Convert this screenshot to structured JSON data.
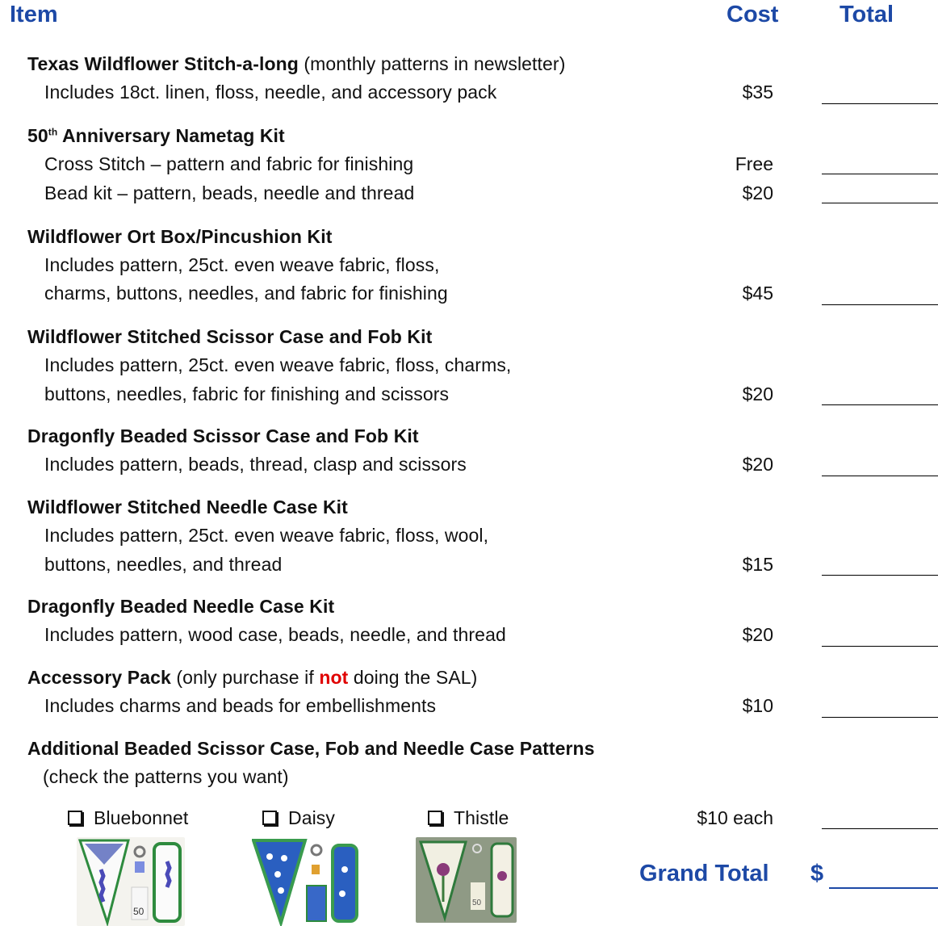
{
  "header": {
    "item": "Item",
    "cost": "Cost",
    "total": "Total"
  },
  "sections": [
    {
      "title_bold": "Texas Wildflower Stitch-a-long",
      "title_rest": " (monthly patterns in newsletter)",
      "lines": [
        {
          "text": "Includes 18ct. linen, floss, needle, and accessory pack",
          "cost": "$35"
        }
      ]
    },
    {
      "title_main": "50",
      "title_sup": "th",
      "title_tail": " Anniversary Nametag Kit",
      "lines": [
        {
          "text": "Cross Stitch – pattern and fabric for finishing",
          "cost": "Free"
        },
        {
          "text": "Bead kit – pattern, beads, needle and thread",
          "cost": "$20"
        }
      ]
    },
    {
      "title": "Wildflower Ort Box/Pincushion Kit",
      "lines": [
        {
          "text": "Includes pattern, 25ct. even weave fabric, floss,"
        },
        {
          "text": "charms, buttons, needles, and fabric for finishing",
          "cost": "$45"
        }
      ]
    },
    {
      "title": "Wildflower Stitched Scissor Case and Fob Kit",
      "lines": [
        {
          "text": "Includes pattern, 25ct. even weave fabric, floss, charms,"
        },
        {
          "text": "buttons, needles, fabric for finishing and scissors",
          "cost": "$20"
        }
      ]
    },
    {
      "title": "Dragonfly Beaded Scissor Case and Fob Kit",
      "lines": [
        {
          "text": "Includes pattern, beads, thread, clasp and scissors",
          "cost": "$20"
        }
      ]
    },
    {
      "title": "Wildflower Stitched Needle Case Kit",
      "lines": [
        {
          "text": "Includes pattern, 25ct. even weave fabric, floss, wool,"
        },
        {
          "text": "buttons, needles, and thread",
          "cost": "$15"
        }
      ]
    },
    {
      "title": "Dragonfly Beaded Needle Case Kit",
      "lines": [
        {
          "text": "Includes pattern, wood case, beads, needle, and thread",
          "cost": "$20"
        }
      ]
    },
    {
      "title_bold": "Accessory Pack",
      "title_pre": " (only purchase if ",
      "title_red": "not",
      "title_post": " doing the SAL)",
      "lines": [
        {
          "text": "Includes charms and beads for embellishments",
          "cost": "$10"
        }
      ]
    },
    {
      "title": "Additional Beaded Scissor Case, Fob and Needle Case Patterns",
      "lines": [
        {
          "text": "(check the patterns you want)"
        }
      ]
    }
  ],
  "patterns": {
    "options": [
      {
        "label": "Bluebonnet"
      },
      {
        "label": "Daisy"
      },
      {
        "label": "Thistle"
      }
    ],
    "cost": "$10 each"
  },
  "grand_total": {
    "label": "Grand Total",
    "currency": "$"
  },
  "colors": {
    "accent": "#1d49a6",
    "emphasis": "#e00000"
  }
}
